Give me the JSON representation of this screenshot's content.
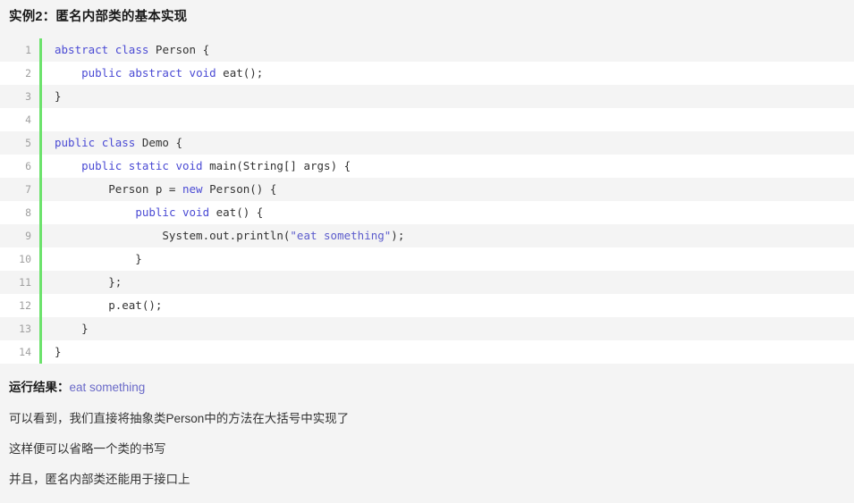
{
  "page": {
    "background_color": "#f4f4f4",
    "title": "实例2：匿名内部类的基本实现"
  },
  "code_block": {
    "language": "java",
    "gutter_divider_color": "#6ce26c",
    "stripe_color": "#f4f4f4",
    "keyword_color": "#4b4bd4",
    "string_color": "#5c5ccc",
    "plain_color": "#333333",
    "lines": [
      {
        "number": "1",
        "tokens": [
          {
            "t": "kw",
            "v": "abstract"
          },
          {
            "t": "pl",
            "v": " "
          },
          {
            "t": "kw",
            "v": "class"
          },
          {
            "t": "pl",
            "v": " Person {"
          }
        ]
      },
      {
        "number": "2",
        "tokens": [
          {
            "t": "pl",
            "v": "    "
          },
          {
            "t": "kw",
            "v": "public"
          },
          {
            "t": "pl",
            "v": " "
          },
          {
            "t": "kw",
            "v": "abstract"
          },
          {
            "t": "pl",
            "v": " "
          },
          {
            "t": "kw",
            "v": "void"
          },
          {
            "t": "pl",
            "v": " eat();"
          }
        ]
      },
      {
        "number": "3",
        "tokens": [
          {
            "t": "pl",
            "v": "}"
          }
        ]
      },
      {
        "number": "4",
        "tokens": [
          {
            "t": "pl",
            "v": ""
          }
        ]
      },
      {
        "number": "5",
        "tokens": [
          {
            "t": "kw",
            "v": "public"
          },
          {
            "t": "pl",
            "v": " "
          },
          {
            "t": "kw",
            "v": "class"
          },
          {
            "t": "pl",
            "v": " Demo {"
          }
        ]
      },
      {
        "number": "6",
        "tokens": [
          {
            "t": "pl",
            "v": "    "
          },
          {
            "t": "kw",
            "v": "public"
          },
          {
            "t": "pl",
            "v": " "
          },
          {
            "t": "kw",
            "v": "static"
          },
          {
            "t": "pl",
            "v": " "
          },
          {
            "t": "kw",
            "v": "void"
          },
          {
            "t": "pl",
            "v": " main(String[] args) {"
          }
        ]
      },
      {
        "number": "7",
        "tokens": [
          {
            "t": "pl",
            "v": "        Person p = "
          },
          {
            "t": "kw",
            "v": "new"
          },
          {
            "t": "pl",
            "v": " Person() {"
          }
        ]
      },
      {
        "number": "8",
        "tokens": [
          {
            "t": "pl",
            "v": "            "
          },
          {
            "t": "kw",
            "v": "public"
          },
          {
            "t": "pl",
            "v": " "
          },
          {
            "t": "kw",
            "v": "void"
          },
          {
            "t": "pl",
            "v": " eat() {"
          }
        ]
      },
      {
        "number": "9",
        "tokens": [
          {
            "t": "pl",
            "v": "                System.out.println("
          },
          {
            "t": "str",
            "v": "\"eat something\""
          },
          {
            "t": "pl",
            "v": ");"
          }
        ]
      },
      {
        "number": "10",
        "tokens": [
          {
            "t": "pl",
            "v": "            }"
          }
        ]
      },
      {
        "number": "11",
        "tokens": [
          {
            "t": "pl",
            "v": "        };"
          }
        ]
      },
      {
        "number": "12",
        "tokens": [
          {
            "t": "pl",
            "v": "        p.eat();"
          }
        ]
      },
      {
        "number": "13",
        "tokens": [
          {
            "t": "pl",
            "v": "    }"
          }
        ]
      },
      {
        "number": "14",
        "tokens": [
          {
            "t": "pl",
            "v": "}"
          }
        ]
      }
    ]
  },
  "result": {
    "label": "运行结果：",
    "value": "eat something"
  },
  "paragraphs": [
    "可以看到，我们直接将抽象类Person中的方法在大括号中实现了",
    "这样便可以省略一个类的书写",
    "并且，匿名内部类还能用于接口上"
  ]
}
